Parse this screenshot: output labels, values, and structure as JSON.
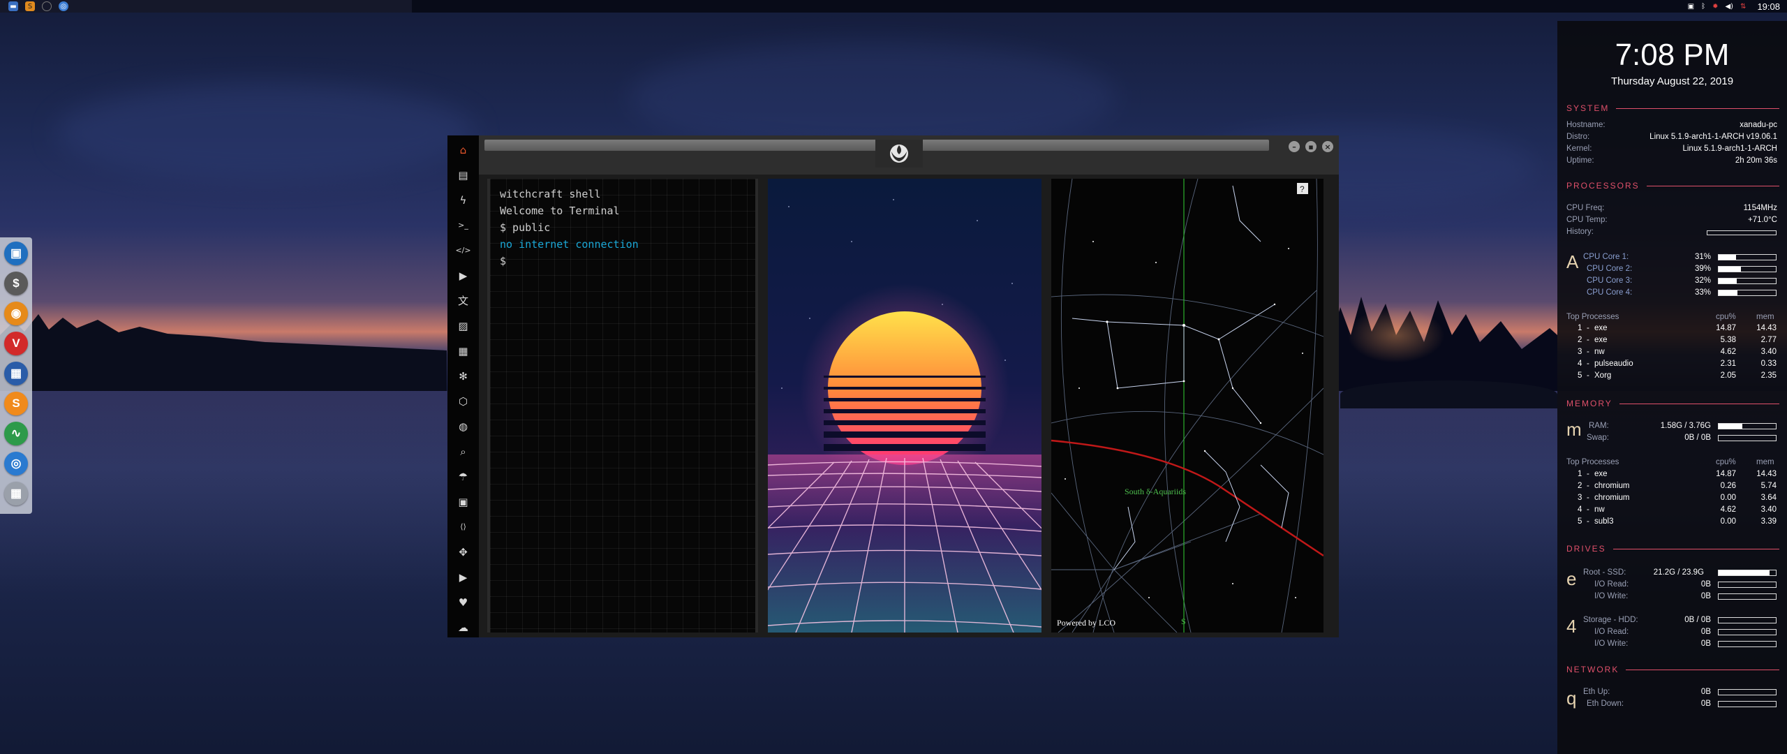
{
  "topbar": {
    "apps": [
      "folder-icon",
      "sublime-text-icon",
      "circle-icon",
      "chromium-icon"
    ],
    "tray_icons": [
      "screenshot-icon",
      "bluetooth-icon",
      "settings-gear-icon",
      "volume-icon",
      "network-icon"
    ],
    "time": "19:08"
  },
  "dock": {
    "items": [
      {
        "name": "files",
        "glyph": "▣",
        "color": "#1f6fbf"
      },
      {
        "name": "terminal",
        "glyph": "$",
        "color": "#5a5a5a"
      },
      {
        "name": "ubuntu-app",
        "glyph": "◉",
        "color": "#e68a1a"
      },
      {
        "name": "vivaldi",
        "glyph": "V",
        "color": "#d22a2a"
      },
      {
        "name": "screenshot-tool",
        "glyph": "▦",
        "color": "#2a5ca8"
      },
      {
        "name": "sublime",
        "glyph": "S",
        "color": "#f08a1c"
      },
      {
        "name": "system-monitor",
        "glyph": "∿",
        "color": "#2d9a4a"
      },
      {
        "name": "chrome",
        "glyph": "◎",
        "color": "#2a7ad0"
      },
      {
        "name": "grid-app",
        "glyph": "▦",
        "color": "#9aa0aa"
      }
    ]
  },
  "sidebar_icons": [
    {
      "name": "home-icon",
      "glyph": "⌂",
      "color": "#e8552a"
    },
    {
      "name": "document-icon",
      "glyph": "▤",
      "color": "#d8d8d8"
    },
    {
      "name": "lightning-icon",
      "glyph": "ϟ",
      "color": "#d8d8d8"
    },
    {
      "name": "terminal-icon",
      "glyph": ">_",
      "color": "#d8d8d8"
    },
    {
      "name": "code-icon",
      "glyph": "</>",
      "color": "#d8d8d8"
    },
    {
      "name": "play-icon",
      "glyph": "▶",
      "color": "#d8d8d8"
    },
    {
      "name": "translate-icon",
      "glyph": "文",
      "color": "#d8d8d8"
    },
    {
      "name": "image-icon",
      "glyph": "▨",
      "color": "#d8d8d8"
    },
    {
      "name": "news-icon",
      "glyph": "▦",
      "color": "#d8d8d8"
    },
    {
      "name": "settings-icon",
      "glyph": "✻",
      "color": "#d8d8d8"
    },
    {
      "name": "hexagon-icon",
      "glyph": "⬡",
      "color": "#d8d8d8"
    },
    {
      "name": "globe-icon",
      "glyph": "◍",
      "color": "#d8d8d8"
    },
    {
      "name": "search-icon",
      "glyph": "⌕",
      "color": "#d8d8d8"
    },
    {
      "name": "umbrella-icon",
      "glyph": "☂",
      "color": "#d8d8d8"
    },
    {
      "name": "contact-icon",
      "glyph": "▣",
      "color": "#d8d8d8"
    },
    {
      "name": "share-icon",
      "glyph": "⟨⟩",
      "color": "#d8d8d8"
    },
    {
      "name": "expand-icon",
      "glyph": "✥",
      "color": "#d8d8d8"
    },
    {
      "name": "youtube-icon",
      "glyph": "▶",
      "color": "#d8d8d8"
    },
    {
      "name": "heart-icon",
      "glyph": "♥",
      "color": "#d8d8d8"
    },
    {
      "name": "cloud-icon",
      "glyph": "☁",
      "color": "#d8d8d8"
    }
  ],
  "terminal": {
    "lines": [
      "witchcraft shell",
      "Welcome to Terminal",
      "$ public"
    ],
    "info_line": "no internet connection",
    "prompt": "$"
  },
  "starmap": {
    "help": "?",
    "constellation_label": "South δ-Aquariids",
    "credit": "Powered by LCO",
    "compass": "S"
  },
  "conky": {
    "time": "7:08 PM",
    "date": "Thursday August 22, 2019",
    "system": {
      "heading": "SYSTEM",
      "rows": [
        {
          "k": "Hostname:",
          "v": "xanadu-pc"
        },
        {
          "k": "Distro:",
          "v": "Linux 5.1.9-arch1-1-ARCH v19.06.1"
        },
        {
          "k": "Kernel:",
          "v": "Linux 5.1.9-arch1-1-ARCH"
        },
        {
          "k": "Uptime:",
          "v": "2h 20m 36s"
        }
      ]
    },
    "processors": {
      "heading": "PROCESSORS",
      "rows": [
        {
          "k": "CPU Freq:",
          "v": "1154MHz"
        },
        {
          "k": "CPU Temp:",
          "v": "+71.0°C"
        },
        {
          "k": "History:",
          "v": ""
        }
      ],
      "glyph": "A",
      "cores": [
        {
          "k": "CPU Core 1:",
          "v": "31%",
          "level": 0.31
        },
        {
          "k": "CPU Core 2:",
          "v": "39%",
          "level": 0.39
        },
        {
          "k": "CPU Core 3:",
          "v": "32%",
          "level": 0.32
        },
        {
          "k": "CPU Core 4:",
          "v": "33%",
          "level": 0.33
        }
      ],
      "top_header": {
        "title": "Top Processes",
        "c1": "cpu%",
        "c2": "mem"
      },
      "top": [
        {
          "n": "1",
          "name": "exe",
          "cpu": "14.87",
          "mem": "14.43"
        },
        {
          "n": "2",
          "name": "exe",
          "cpu": "5.38",
          "mem": "2.77"
        },
        {
          "n": "3",
          "name": "nw",
          "cpu": "4.62",
          "mem": "3.40"
        },
        {
          "n": "4",
          "name": "pulseaudio",
          "cpu": "2.31",
          "mem": "0.33"
        },
        {
          "n": "5",
          "name": "Xorg",
          "cpu": "2.05",
          "mem": "2.35"
        }
      ]
    },
    "memory": {
      "heading": "MEMORY",
      "glyph": "m",
      "rows": [
        {
          "k": "RAM:",
          "v": "1.58G / 3.76G",
          "level": 0.42
        },
        {
          "k": "Swap:",
          "v": "0B / 0B",
          "level": 0
        }
      ],
      "top_header": {
        "title": "Top Processes",
        "c1": "cpu%",
        "c2": "mem"
      },
      "top": [
        {
          "n": "1",
          "name": "exe",
          "cpu": "14.87",
          "mem": "14.43"
        },
        {
          "n": "2",
          "name": "chromium",
          "cpu": "0.26",
          "mem": "5.74"
        },
        {
          "n": "3",
          "name": "chromium",
          "cpu": "0.00",
          "mem": "3.64"
        },
        {
          "n": "4",
          "name": "nw",
          "cpu": "4.62",
          "mem": "3.40"
        },
        {
          "n": "5",
          "name": "subl3",
          "cpu": "0.00",
          "mem": "3.39"
        }
      ]
    },
    "drives": {
      "heading": "DRIVES",
      "root": {
        "glyph": "e",
        "label": "Root  -  SSD:",
        "v": "21.2G / 23.9G",
        "level": 0.89,
        "io": [
          {
            "k": "I/O Read:",
            "v": "0B"
          },
          {
            "k": "I/O Write:",
            "v": "0B"
          }
        ]
      },
      "storage": {
        "glyph": "4",
        "label": "Storage  -  HDD:",
        "v": "0B / 0B",
        "level": 0,
        "io": [
          {
            "k": "I/O Read:",
            "v": "0B"
          },
          {
            "k": "I/O Write:",
            "v": "0B"
          }
        ]
      }
    },
    "network": {
      "heading": "NETWORK",
      "glyph": "q",
      "rows": [
        {
          "k": "Eth Up:",
          "v": "0B"
        },
        {
          "k": "Eth Down:",
          "v": "0B"
        }
      ]
    }
  }
}
